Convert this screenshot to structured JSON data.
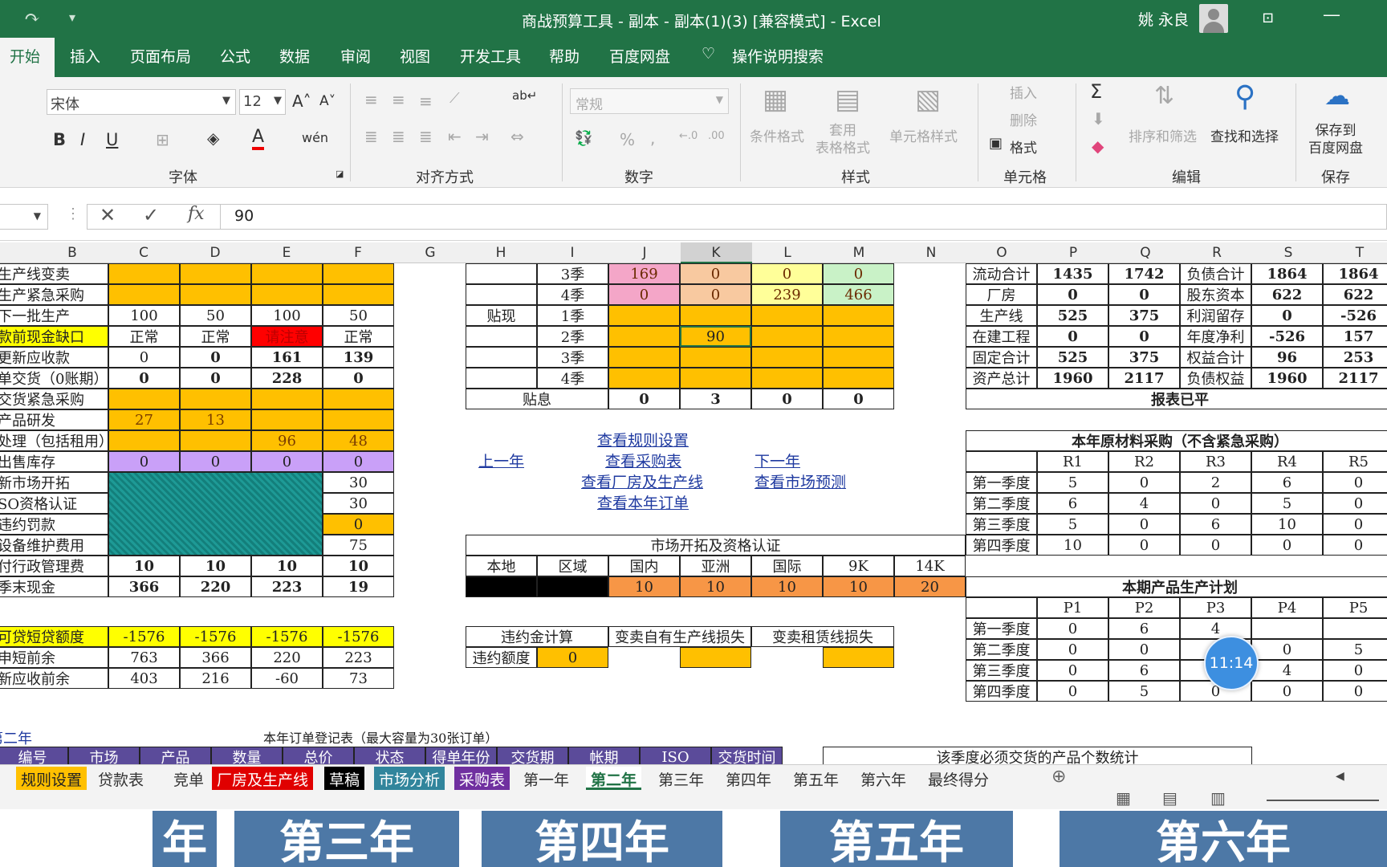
{
  "title": {
    "text": "商战预算工具 - 副本 - 副本(1)(3)  [兼容模式]  -  Excel",
    "user": "姚 永良"
  },
  "menu": [
    "开始",
    "插入",
    "页面布局",
    "公式",
    "数据",
    "审阅",
    "视图",
    "开发工具",
    "帮助",
    "百度网盘",
    "操作说明搜索"
  ],
  "ribbon": {
    "font_name": "宋体",
    "font_size": "12",
    "number_format": "常规",
    "groups": [
      "字体",
      "对齐方式",
      "数字",
      "样式",
      "单元格",
      "编辑",
      "保存"
    ],
    "styles": [
      "条件格式",
      "套用\n表格格式",
      "单元格样式"
    ],
    "cells_items": [
      "插入",
      "删除",
      "格式"
    ],
    "edit_items": [
      "排序和筛选",
      "查找和选择"
    ],
    "save_label": "保存到\n百度网盘"
  },
  "formula": {
    "value": "90"
  },
  "columns": [
    "B",
    "C",
    "D",
    "E",
    "F",
    "G",
    "H",
    "I",
    "J",
    "K",
    "L",
    "M",
    "N",
    "O",
    "P",
    "Q",
    "R",
    "S",
    "T"
  ],
  "left_rows": [
    {
      "label": "生产线变卖",
      "cells": [
        "",
        "",
        "",
        ""
      ]
    },
    {
      "label": "生产紧急采购",
      "cells": [
        "",
        "",
        "",
        ""
      ]
    },
    {
      "label": "下一批生产",
      "cells": [
        "100",
        "50",
        "100",
        "50"
      ]
    },
    {
      "label": "款前现金缺口",
      "cells": [
        "正常",
        "正常",
        "请注意",
        "正常"
      ]
    },
    {
      "label": "更新应收款",
      "cells": [
        "0",
        "0",
        "161",
        "139"
      ]
    },
    {
      "label": "单交货（0账期）",
      "cells": [
        "0",
        "0",
        "228",
        "0"
      ]
    },
    {
      "label": "交货紧急采购",
      "cells": [
        "",
        "",
        "",
        ""
      ]
    },
    {
      "label": "产品研发",
      "cells": [
        "27",
        "13",
        "",
        ""
      ]
    },
    {
      "label": "处理（包括租用）",
      "cells": [
        "",
        "",
        "96",
        "48"
      ]
    },
    {
      "label": "出售库存",
      "cells": [
        "0",
        "0",
        "0",
        "0"
      ]
    },
    {
      "label": "新市场开拓",
      "cells": [
        "",
        "",
        "",
        "30"
      ]
    },
    {
      "label": "SO资格认证",
      "cells": [
        "",
        "",
        "",
        "30"
      ]
    },
    {
      "label": "违约罚款",
      "cells": [
        "",
        "",
        "",
        "0"
      ]
    },
    {
      "label": "设备维护费用",
      "cells": [
        "",
        "",
        "",
        "75"
      ]
    },
    {
      "label": "付行政管理费",
      "cells": [
        "10",
        "10",
        "10",
        "10"
      ]
    },
    {
      "label": "季末现金",
      "cells": [
        "366",
        "220",
        "223",
        "19"
      ]
    }
  ],
  "left_rows2": [
    {
      "label": "可贷短贷额度",
      "cells": [
        "-1576",
        "-1576",
        "-1576",
        "-1576"
      ]
    },
    {
      "label": "申短前余",
      "cells": [
        "763",
        "366",
        "220",
        "223"
      ]
    },
    {
      "label": "新应收前余",
      "cells": [
        "403",
        "216",
        "-60",
        "73"
      ]
    }
  ],
  "discount": {
    "rows": [
      {
        "h": "",
        "i": "3季",
        "v": [
          "169",
          "0",
          "0",
          "0"
        ]
      },
      {
        "h": "",
        "i": "4季",
        "v": [
          "0",
          "0",
          "239",
          "466"
        ]
      },
      {
        "h": "贴现",
        "i": "1季",
        "v": [
          "",
          "",
          "",
          ""
        ]
      },
      {
        "h": "",
        "i": "2季",
        "v": [
          "",
          "90",
          "",
          ""
        ]
      },
      {
        "h": "",
        "i": "3季",
        "v": [
          "",
          "",
          "",
          ""
        ]
      },
      {
        "h": "",
        "i": "4季",
        "v": [
          "",
          "",
          "",
          ""
        ]
      }
    ],
    "interest_label": "贴息",
    "interest": [
      "0",
      "3",
      "0",
      "0"
    ]
  },
  "links": {
    "prev": "上一年",
    "next": "下一年",
    "rules": "查看规则设置",
    "purchase": "查看采购表",
    "factory": "查看厂房及生产线",
    "orders": "查看本年订单",
    "forecast": "查看市场预测"
  },
  "market": {
    "title": "市场开拓及资格认证",
    "headers": [
      "本地",
      "区域",
      "国内",
      "亚洲",
      "国际",
      "9K",
      "14K"
    ],
    "values": [
      "",
      "",
      "10",
      "10",
      "10",
      "10",
      "20"
    ]
  },
  "penalty": {
    "title": "违约金计算",
    "sell_own": "变卖自有生产线损失",
    "sell_lease": "变卖租赁线损失",
    "label": "违约额度",
    "value": "0"
  },
  "balance": {
    "rows": [
      {
        "a": "流动合计",
        "p": "1435",
        "q": "1742",
        "r": "负债合计",
        "s": "1864",
        "t": "1864"
      },
      {
        "a": "厂房",
        "p": "0",
        "q": "0",
        "r": "股东资本",
        "s": "622",
        "t": "622"
      },
      {
        "a": "生产线",
        "p": "525",
        "q": "375",
        "r": "利润留存",
        "s": "0",
        "t": "-526"
      },
      {
        "a": "在建工程",
        "p": "0",
        "q": "0",
        "r": "年度净利",
        "s": "-526",
        "t": "157"
      },
      {
        "a": "固定合计",
        "p": "525",
        "q": "375",
        "r": "权益合计",
        "s": "96",
        "t": "253"
      },
      {
        "a": "资产总计",
        "p": "1960",
        "q": "2117",
        "r": "负债权益",
        "s": "1960",
        "t": "2117"
      }
    ],
    "status": "报表已平"
  },
  "materials": {
    "title": "本年原材料采购（不含紧急采购）",
    "headers": [
      "R1",
      "R2",
      "R3",
      "R4",
      "R5"
    ],
    "rows": [
      {
        "q": "第一季度",
        "v": [
          "5",
          "0",
          "2",
          "6",
          "0"
        ]
      },
      {
        "q": "第二季度",
        "v": [
          "6",
          "4",
          "0",
          "5",
          "0"
        ]
      },
      {
        "q": "第三季度",
        "v": [
          "5",
          "0",
          "6",
          "10",
          "0"
        ]
      },
      {
        "q": "第四季度",
        "v": [
          "10",
          "0",
          "0",
          "0",
          "0"
        ]
      }
    ]
  },
  "production": {
    "title": "本期产品生产计划",
    "headers": [
      "P1",
      "P2",
      "P3",
      "P4",
      "P5"
    ],
    "rows": [
      {
        "q": "第一季度",
        "v": [
          "0",
          "6",
          "4",
          "",
          ""
        ]
      },
      {
        "q": "第二季度",
        "v": [
          "0",
          "0",
          "",
          "0",
          "5"
        ]
      },
      {
        "q": "第三季度",
        "v": [
          "0",
          "6",
          "",
          "4",
          "0"
        ]
      },
      {
        "q": "第四季度",
        "v": [
          "0",
          "5",
          "0",
          "0",
          "0"
        ]
      }
    ]
  },
  "orders": {
    "year": "第二年",
    "title": "本年订单登记表（最大容量为30张订单）",
    "headers": [
      "编号",
      "市场",
      "产品",
      "数量",
      "总价",
      "状态",
      "得单年份",
      "交货期",
      "帐期",
      "ISO",
      "交货时间"
    ]
  },
  "delivery_box": "该季度必须交货的产品个数统计",
  "timer": "11:14",
  "sheets": [
    {
      "name": "规则设置",
      "bg": "#ffc000",
      "fg": "#222"
    },
    {
      "name": "贷款表",
      "bg": "",
      "fg": "#333"
    },
    {
      "name": "竞单",
      "bg": "",
      "fg": "#333"
    },
    {
      "name": "厂房及生产线",
      "bg": "#e00000",
      "fg": "#fff"
    },
    {
      "name": "草稿",
      "bg": "#000000",
      "fg": "#fff"
    },
    {
      "name": "市场分析",
      "bg": "#31859c",
      "fg": "#fff"
    },
    {
      "name": "采购表",
      "bg": "#7030a0",
      "fg": "#fff"
    },
    {
      "name": "第一年",
      "bg": "",
      "fg": "#333"
    },
    {
      "name": "第二年",
      "bg": "#ffffff",
      "fg": "#217346"
    },
    {
      "name": "第三年",
      "bg": "",
      "fg": "#333"
    },
    {
      "name": "第四年",
      "bg": "",
      "fg": "#333"
    },
    {
      "name": "第五年",
      "bg": "",
      "fg": "#333"
    },
    {
      "name": "第六年",
      "bg": "",
      "fg": "#333"
    },
    {
      "name": "最终得分",
      "bg": "",
      "fg": "#333"
    }
  ],
  "banner": [
    "年",
    "第三年",
    "第四年",
    "第五年",
    "第六年"
  ],
  "colors": {
    "excel_green": "#217346",
    "orange": "#ffc000",
    "pink": "#f4a6c8",
    "peach": "#f8c9a0",
    "yellow": "#ffff99",
    "mint": "#c9f2c7",
    "purple": "#c9a0f8",
    "teal": "#2aa198",
    "dark_orange": "#f79646"
  }
}
